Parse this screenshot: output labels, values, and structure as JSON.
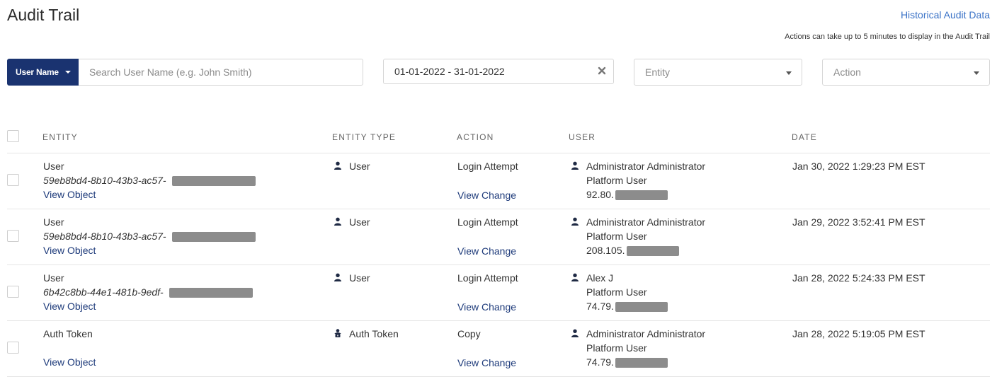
{
  "page_title": "Audit Trail",
  "historical_link": "Historical Audit Data",
  "notice": "Actions can take up to 5 minutes to display in the Audit Trail",
  "filters": {
    "user_button_label": "User Name",
    "search_placeholder": "Search User Name (e.g. John Smith)",
    "date_range": "01-01-2022 - 31-01-2022",
    "entity_placeholder": "Entity",
    "action_placeholder": "Action"
  },
  "columns": {
    "entity": "ENTITY",
    "entity_type": "ENTITY TYPE",
    "action": "ACTION",
    "user": "USER",
    "date": "DATE"
  },
  "rows": [
    {
      "entity_name": "User",
      "entity_id": "59eb8bd4-8b10-43b3-ac57-",
      "entity_link": "View Object",
      "entity_type": "User",
      "entity_type_icon": "user-icon",
      "action": "Login Attempt",
      "action_link": "View Change",
      "user_name": "Administrator Administrator",
      "user_role": "Platform User",
      "user_ip": "92.80.",
      "date": "Jan 30, 2022 1:29:23 PM EST"
    },
    {
      "entity_name": "User",
      "entity_id": "59eb8bd4-8b10-43b3-ac57-",
      "entity_link": "View Object",
      "entity_type": "User",
      "entity_type_icon": "user-icon",
      "action": "Login Attempt",
      "action_link": "View Change",
      "user_name": "Administrator Administrator",
      "user_role": "Platform User",
      "user_ip": "208.105.",
      "date": "Jan 29, 2022 3:52:41 PM EST"
    },
    {
      "entity_name": "User",
      "entity_id": "6b42c8bb-44e1-481b-9edf-",
      "entity_link": "View Object",
      "entity_type": "User",
      "entity_type_icon": "user-icon",
      "action": "Login Attempt",
      "action_link": "View Change",
      "user_name": "Alex J",
      "user_role": "Platform User",
      "user_ip": "74.79.",
      "date": "Jan 28, 2022 5:24:33 PM EST"
    },
    {
      "entity_name": "Auth Token",
      "entity_id": "",
      "entity_link": "View Object",
      "entity_type": "Auth Token",
      "entity_type_icon": "user-lock-icon",
      "action": "Copy",
      "action_link": "View Change",
      "user_name": "Administrator Administrator",
      "user_role": "Platform User",
      "user_ip": "74.79.",
      "date": "Jan 28, 2022 5:19:05 PM EST"
    }
  ],
  "colors": {
    "primary": "#1a3370",
    "link": "#1d3a7a",
    "accent_link": "#3b73c7",
    "redaction": "#8c8c8c"
  }
}
